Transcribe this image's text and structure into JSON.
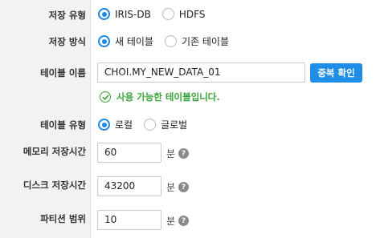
{
  "form": {
    "storage_type": {
      "label": "저장 유형",
      "options": [
        "IRIS-DB",
        "HDFS"
      ],
      "selected": "IRIS-DB"
    },
    "storage_method": {
      "label": "저장 방식",
      "options": [
        "새 테이블",
        "기존 테이블"
      ],
      "selected": "새 테이블"
    },
    "table_name": {
      "label": "테이블 이름",
      "value": "CHOI.MY_NEW_DATA_01",
      "check_button": "중복 확인",
      "validation_message": "사용 가능한 테이블입니다."
    },
    "table_type": {
      "label": "테이블 유형",
      "options": [
        "로컬",
        "글로벌"
      ],
      "selected": "로컬"
    },
    "memory_retention": {
      "label": "메모리 저장시간",
      "value": "60",
      "unit": "분"
    },
    "disk_retention": {
      "label": "디스크 저장시간",
      "value": "43200",
      "unit": "분"
    },
    "partition_range": {
      "label": "파티션 범위",
      "value": "10",
      "unit": "분"
    }
  },
  "icons": {
    "help": "question-circle-icon",
    "valid": "check-circle-icon"
  },
  "colors": {
    "accent": "#1e88e5",
    "button": "#1f8ee6",
    "success": "#3aa53a",
    "label_bg": "#f2f2f2"
  }
}
